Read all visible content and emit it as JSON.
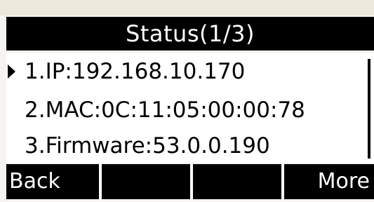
{
  "screen": {
    "title": "Status(1/3)"
  },
  "items": [
    {
      "label": "1.IP:192.168.10.170",
      "selected": true
    },
    {
      "label": "2.MAC:0C:11:05:00:00:78",
      "selected": false
    },
    {
      "label": "3.Firmware:53.0.0.190",
      "selected": false
    }
  ],
  "softkeys": {
    "key1": "Back",
    "key2": "",
    "key3": "",
    "key4": "More"
  },
  "colors": {
    "lcd_background": "#ffffff",
    "bar_background": "#000000",
    "bar_text": "#ffffff",
    "frame": "#ede9dc"
  },
  "icons": {
    "cursor": "selection-arrow-icon"
  }
}
